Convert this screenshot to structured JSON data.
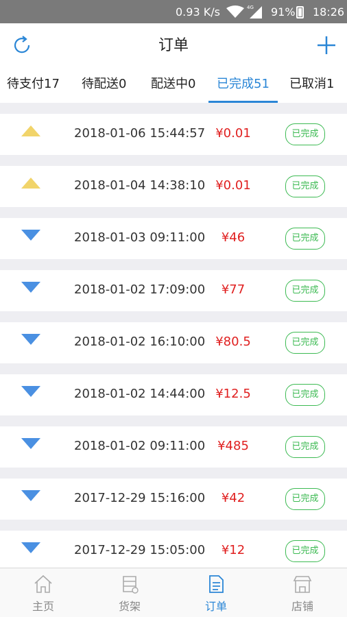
{
  "status": {
    "speed": "0.93 K/s",
    "network": "4G",
    "battery": "91%",
    "time": "18:26"
  },
  "nav": {
    "title": "订单",
    "refresh_icon": "refresh-icon",
    "add_icon": "plus-icon"
  },
  "tabs": [
    {
      "label": "待支付17",
      "active": false
    },
    {
      "label": "待配送0",
      "active": false
    },
    {
      "label": "配送中0",
      "active": false
    },
    {
      "label": "已完成51",
      "active": true
    },
    {
      "label": "已取消1",
      "active": false
    }
  ],
  "orders": [
    {
      "direction": "up",
      "date": "2018-01-06 15:44:57",
      "price": "¥0.01",
      "status": "已完成"
    },
    {
      "direction": "up",
      "date": "2018-01-04 14:38:10",
      "price": "¥0.01",
      "status": "已完成"
    },
    {
      "direction": "down",
      "date": "2018-01-03 09:11:00",
      "price": "¥46",
      "status": "已完成"
    },
    {
      "direction": "down",
      "date": "2018-01-02 17:09:00",
      "price": "¥77",
      "status": "已完成"
    },
    {
      "direction": "down",
      "date": "2018-01-02 16:10:00",
      "price": "¥80.5",
      "status": "已完成"
    },
    {
      "direction": "down",
      "date": "2018-01-02 14:44:00",
      "price": "¥12.5",
      "status": "已完成"
    },
    {
      "direction": "down",
      "date": "2018-01-02 09:11:00",
      "price": "¥485",
      "status": "已完成"
    },
    {
      "direction": "down",
      "date": "2017-12-29 15:16:00",
      "price": "¥42",
      "status": "已完成"
    },
    {
      "direction": "down",
      "date": "2017-12-29 15:05:00",
      "price": "¥12",
      "status": "已完成"
    }
  ],
  "tabbar": [
    {
      "label": "主页",
      "icon": "home-icon",
      "active": false
    },
    {
      "label": "货架",
      "icon": "shelf-icon",
      "active": false
    },
    {
      "label": "订单",
      "icon": "order-icon",
      "active": true
    },
    {
      "label": "店铺",
      "icon": "store-icon",
      "active": false
    }
  ],
  "colors": {
    "accent": "#2a86d6",
    "price": "#e02020",
    "badge": "#3cba52",
    "up_arrow": "#f1d46a",
    "down_arrow": "#4a90e2"
  }
}
